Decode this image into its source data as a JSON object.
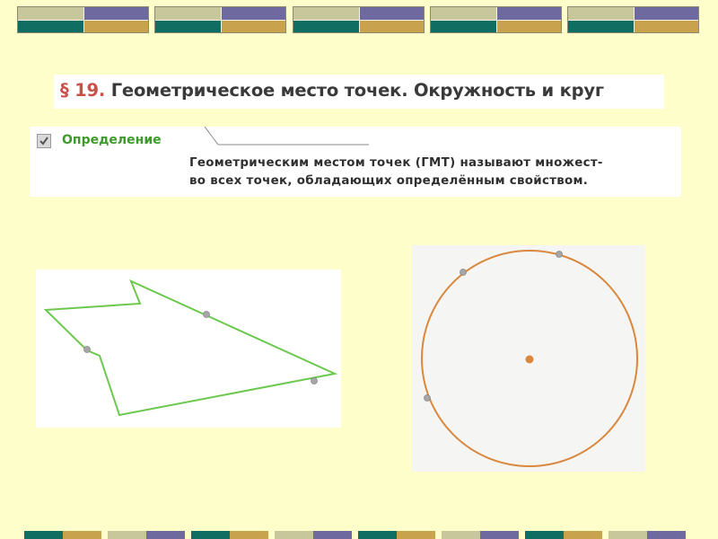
{
  "title": {
    "number": "§ 19.",
    "text": "Геометрическое место точек. Окружность и круг"
  },
  "definition": {
    "label": "Определение",
    "line1": "Геометрическим местом точек (ГМТ) называют множест-",
    "line2": "во всех точек, обладающих определённым свойством."
  },
  "colors": {
    "accent_title_number": "#C9514A",
    "definition_label": "#3E9A2C",
    "polygon": "#6CC84E",
    "circle": "#D9883E",
    "point": "#A6A6A6",
    "background": "#FEFECB",
    "tile_beige": "#C7C79B",
    "tile_purple": "#6E6A9F",
    "tile_teal": "#0F6D61",
    "tile_gold": "#C9A24E"
  },
  "icons": {
    "definition_marker": "checkbox-icon"
  }
}
